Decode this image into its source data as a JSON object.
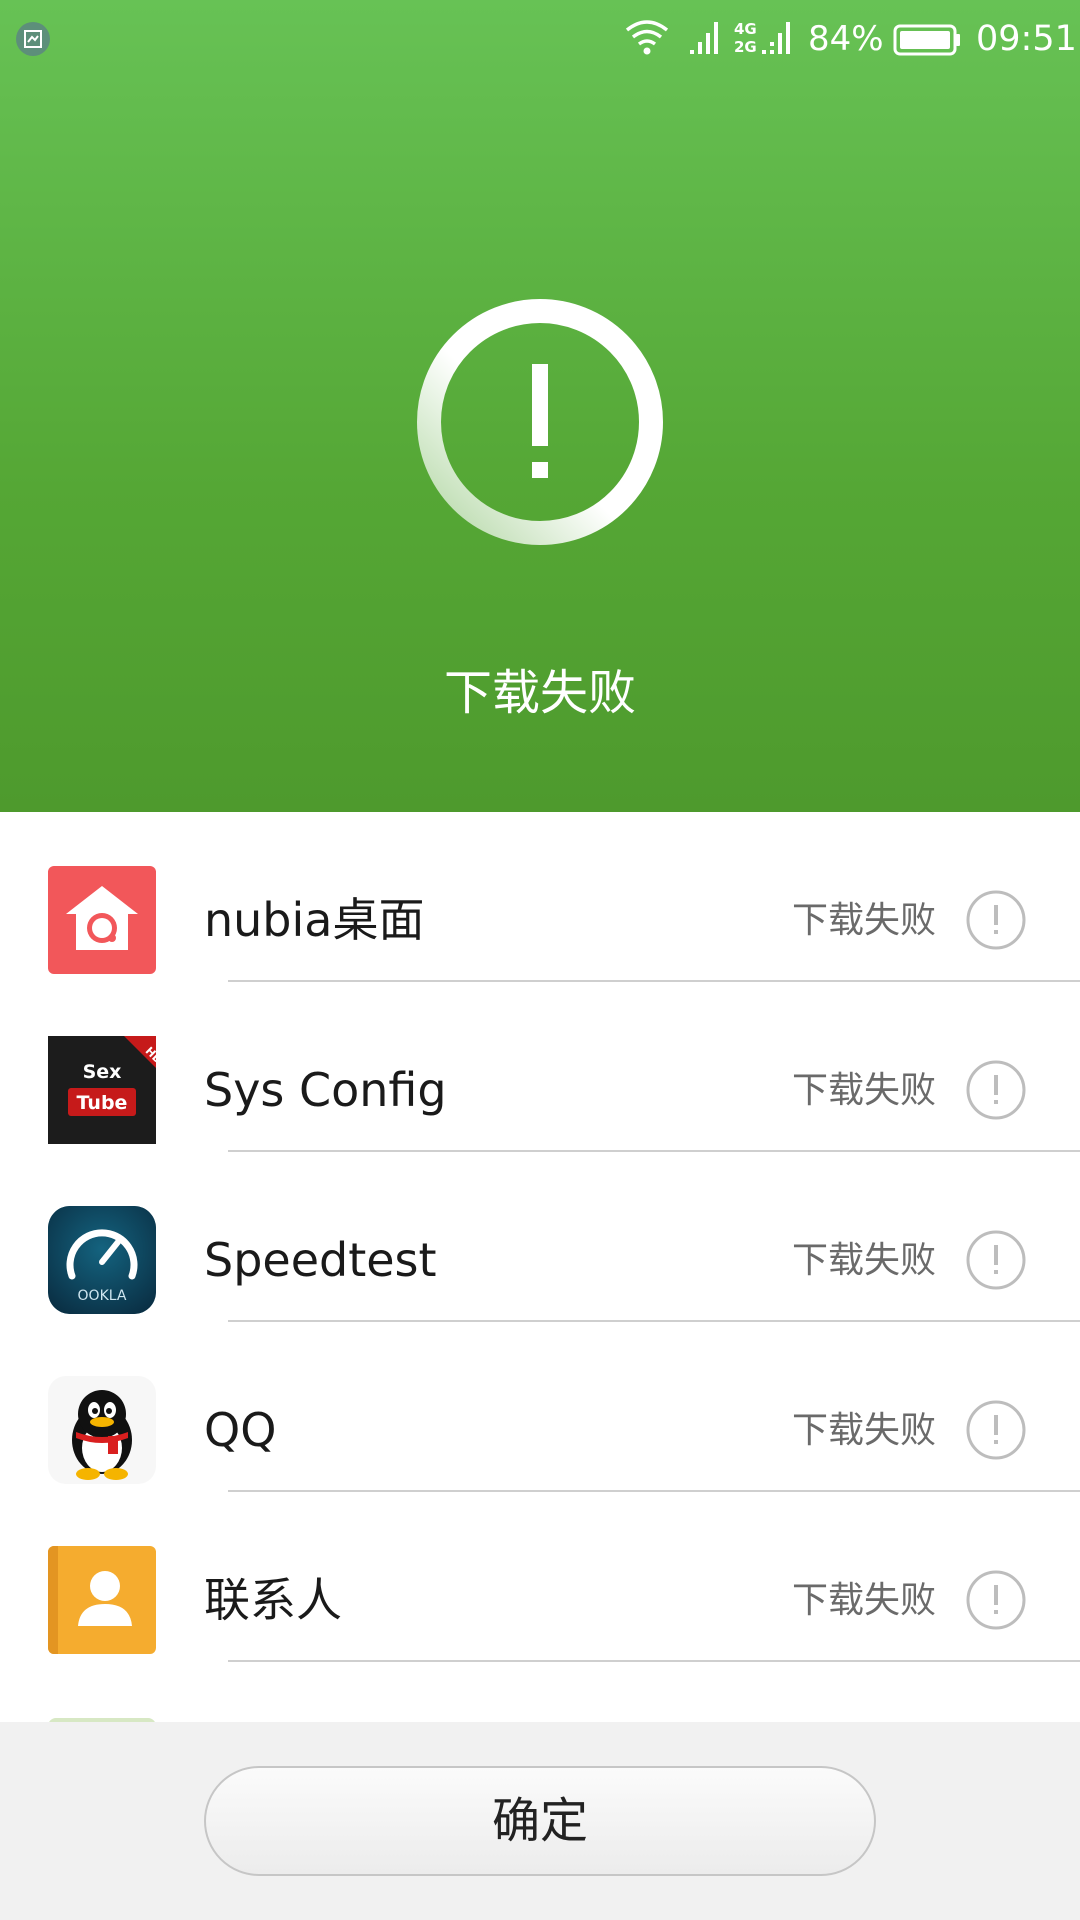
{
  "statusbar": {
    "battery_percent": "84%",
    "time": "09:51",
    "network_label_top": "4G",
    "network_label_bottom": "2G",
    "icons": [
      "screenshot-icon",
      "wifi-icon",
      "signal-icon",
      "signal-icon",
      "battery-icon"
    ]
  },
  "header": {
    "status": "下载失败",
    "icon": "exclamation-icon",
    "background_color": "#55a735"
  },
  "apps": [
    {
      "name": "nubia桌面",
      "status": "下载失败",
      "icon": "nubia-launcher-icon"
    },
    {
      "name": "Sys Config",
      "status": "下载失败",
      "icon": "sextube-icon",
      "icon_text_1": "Sex",
      "icon_text_2": "Tube",
      "icon_badge": "HD"
    },
    {
      "name": "Speedtest",
      "status": "下载失败",
      "icon": "speedtest-icon",
      "icon_text": "OOKLA"
    },
    {
      "name": "QQ",
      "status": "下载失败",
      "icon": "qq-penguin-icon"
    },
    {
      "name": "联系人",
      "status": "下载失败",
      "icon": "contacts-icon"
    }
  ],
  "footer": {
    "confirm_label": "确定"
  }
}
